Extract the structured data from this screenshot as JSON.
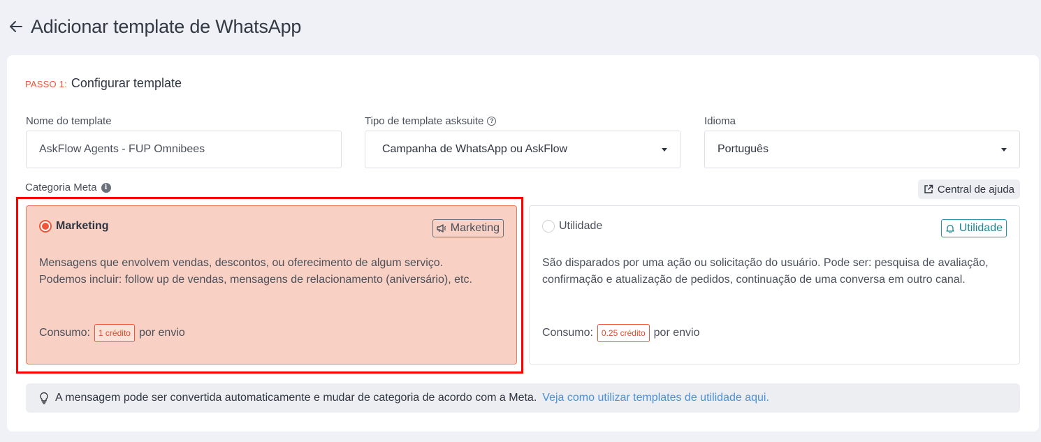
{
  "header": {
    "title": "Adicionar template de WhatsApp",
    "back_icon": "arrow-left-icon"
  },
  "step": {
    "label": "PASSO 1:",
    "title": "Configurar template"
  },
  "fields": {
    "name": {
      "label": "Nome do template",
      "value": "AskFlow Agents - FUP Omnibees"
    },
    "type": {
      "label": "Tipo de template asksuite",
      "value": "Campanha de WhatsApp ou AskFlow"
    },
    "language": {
      "label": "Idioma",
      "value": "Português"
    }
  },
  "category": {
    "label": "Categoria Meta",
    "help_center": "Central de ajuda",
    "options": [
      {
        "name": "Marketing",
        "badge": "Marketing",
        "selected": true,
        "description": "Mensagens que envolvem vendas, descontos, ou oferecimento de algum serviço. Podemos incluir: follow up de vendas, mensagens de relacionamento (aniversário), etc.",
        "consume_label": "Consumo:",
        "credit": "1 crédito",
        "per_send": "por envio"
      },
      {
        "name": "Utilidade",
        "badge": "Utilidade",
        "selected": false,
        "description": "São disparados por uma ação ou solicitação do usuário. Pode ser: pesquisa de avaliação, confirmação e atualização de pedidos, continuação de uma conversa em outro canal.",
        "consume_label": "Consumo:",
        "credit": "0.25 crédito",
        "per_send": "por envio"
      }
    ]
  },
  "notice": {
    "text": "A mensagem pode ser convertida automaticamente e mudar de categoria de acordo com a Meta.",
    "link": "Veja como utilizar templates de utilidade aqui."
  },
  "colors": {
    "accent": "#f0553a",
    "selected_bg": "#f9d0c4",
    "utility": "#2196a6",
    "link": "#4a90d9",
    "highlight": "#ff0000"
  }
}
